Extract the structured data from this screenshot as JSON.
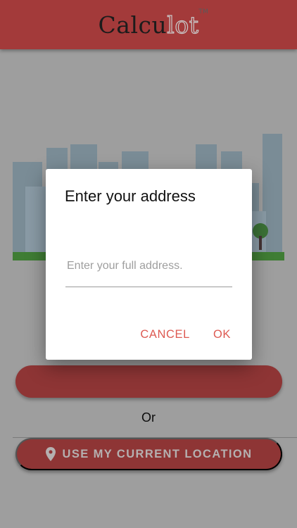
{
  "app": {
    "logo_primary": "Calcu",
    "logo_secondary": "lot",
    "logo_tm": "TM",
    "colors": {
      "header": "#c64949",
      "accent": "#e35b55",
      "overlay": "rgba(0,0,0,0.38)"
    }
  },
  "main": {
    "or_text": "Or",
    "location_button_label": "USE MY CURRENT LOCATION",
    "location_icon": "map-pin-icon"
  },
  "dialog": {
    "title": "Enter your address",
    "input_placeholder": "Enter your full address.",
    "input_value": "",
    "cancel_label": "CANCEL",
    "ok_label": "OK"
  }
}
